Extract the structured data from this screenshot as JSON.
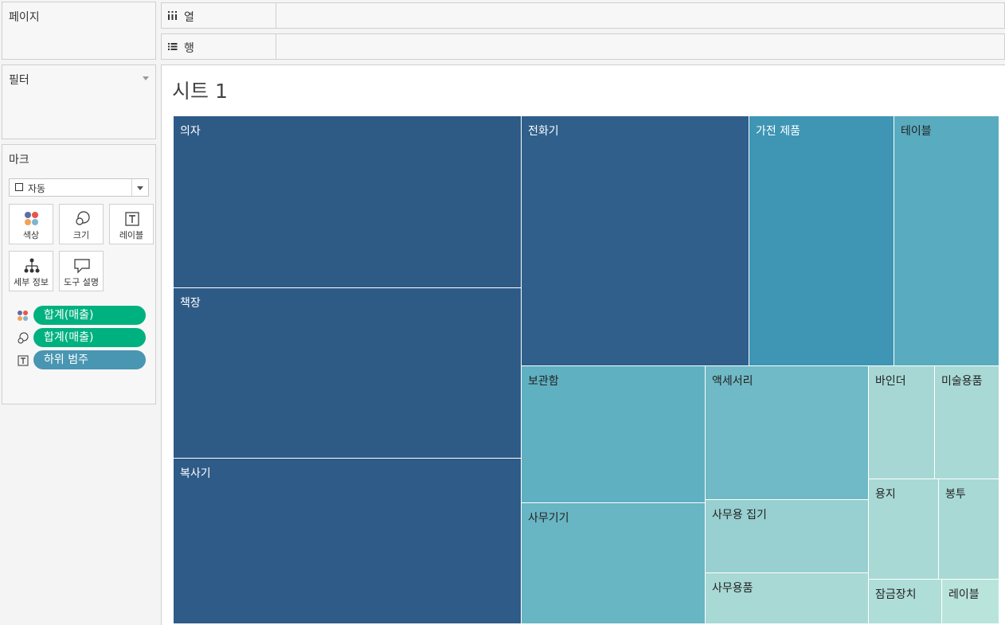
{
  "panels": {
    "pages_title": "페이지",
    "filters_title": "필터",
    "marks_title": "마크"
  },
  "marks": {
    "type_select": "자동",
    "buttons": {
      "color": "색상",
      "size": "크기",
      "label": "레이블",
      "detail": "세부 정보",
      "tooltip": "도구 설명"
    },
    "pills": [
      {
        "text": "합계(매출)",
        "icon": "color-icon",
        "color": "#00b180"
      },
      {
        "text": "합계(매출)",
        "icon": "size-icon",
        "color": "#00b180"
      },
      {
        "text": "하위 범주",
        "icon": "label-icon",
        "color": "#4996b2"
      }
    ]
  },
  "shelves": {
    "columns_label": "열",
    "rows_label": "행"
  },
  "sheet_title": "시트 1",
  "chart_data": {
    "type": "treemap",
    "size_measure": "합계(매출)",
    "color_measure": "합계(매출)",
    "label_field": "하위 범주",
    "items": [
      {
        "label": "의자",
        "value": 1.0,
        "color": "#2e5a86"
      },
      {
        "label": "책장",
        "value": 0.99,
        "color": "#2e5a86"
      },
      {
        "label": "복사기",
        "value": 0.97,
        "color": "#2e5b87"
      },
      {
        "label": "전화기",
        "value": 0.92,
        "color": "#2f5f8a"
      },
      {
        "label": "가전 제품",
        "value": 0.58,
        "color": "#3e95b4"
      },
      {
        "label": "테이블",
        "value": 0.42,
        "color": "#59abbf"
      },
      {
        "label": "보관함",
        "value": 0.38,
        "color": "#5fb0c0"
      },
      {
        "label": "사무기기",
        "value": 0.35,
        "color": "#68b5c4"
      },
      {
        "label": "액세서리",
        "value": 0.31,
        "color": "#6fbac6"
      },
      {
        "label": "사무용 집기",
        "value": 0.17,
        "color": "#98cfd0"
      },
      {
        "label": "사무용품",
        "value": 0.13,
        "color": "#a8d9d5"
      },
      {
        "label": "바인더",
        "value": 0.11,
        "color": "#a7d7d4"
      },
      {
        "label": "미술용품",
        "value": 0.11,
        "color": "#a8d9d5"
      },
      {
        "label": "용지",
        "value": 0.1,
        "color": "#a8d9d5"
      },
      {
        "label": "봉투",
        "value": 0.09,
        "color": "#a8d9d5"
      },
      {
        "label": "잠금장치",
        "value": 0.07,
        "color": "#afddd8"
      },
      {
        "label": "레이블",
        "value": 0.05,
        "color": "#b9e4dc"
      }
    ]
  }
}
